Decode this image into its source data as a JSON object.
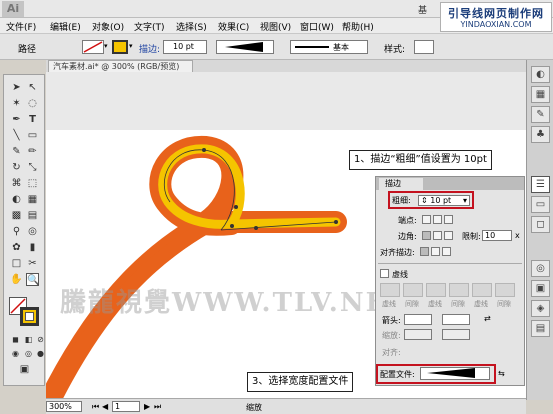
{
  "app": {
    "logo": "Ai",
    "title_right": "基"
  },
  "watermark_header": {
    "title": "引导线网页制作网",
    "url": "YINDAOXIAN.COM"
  },
  "menu": [
    "文件(F)",
    "编辑(E)",
    "对象(O)",
    "文字(T)",
    "选择(S)",
    "效果(C)",
    "视图(V)",
    "窗口(W)",
    "帮助(H)"
  ],
  "control_bar": {
    "selection_label": "路径",
    "stroke_label": "描边:",
    "stroke_weight": "10 pt",
    "profile_label": "基本",
    "style_label": "样式:"
  },
  "document_tab": "汽车素材.ai* @ 300% (RGB/预览)",
  "canvas_watermark": "騰龍視覺WWW.TLV.NET",
  "stroke_panel": {
    "tab_label": "描边",
    "weight_label": "粗细:",
    "weight_value": "10 pt",
    "cap_label": "端点:",
    "corner_label": "边角:",
    "limit_label": "限制:",
    "limit_value": "10",
    "limit_unit": "x",
    "align_label": "对齐描边:",
    "dashed_label": "虚线",
    "dash_fields": [
      "虚线",
      "间隙",
      "虚线",
      "间隙",
      "虚线",
      "间隙"
    ],
    "arrow_label": "箭头:",
    "scale_label": "缩放:",
    "align2_label": "对齐:",
    "profile_label": "配置文件:"
  },
  "callouts": {
    "step1": "1、描边“粗细”值设置为 10pt",
    "step3": "3、选择宽度配置文件"
  },
  "status_bar": {
    "zoom": "300%",
    "page": "1",
    "tool": "缩放"
  },
  "colors": {
    "stroke_outer": "#e8621b",
    "stroke_inner": "#f5c400",
    "highlight": "#c4121f"
  }
}
